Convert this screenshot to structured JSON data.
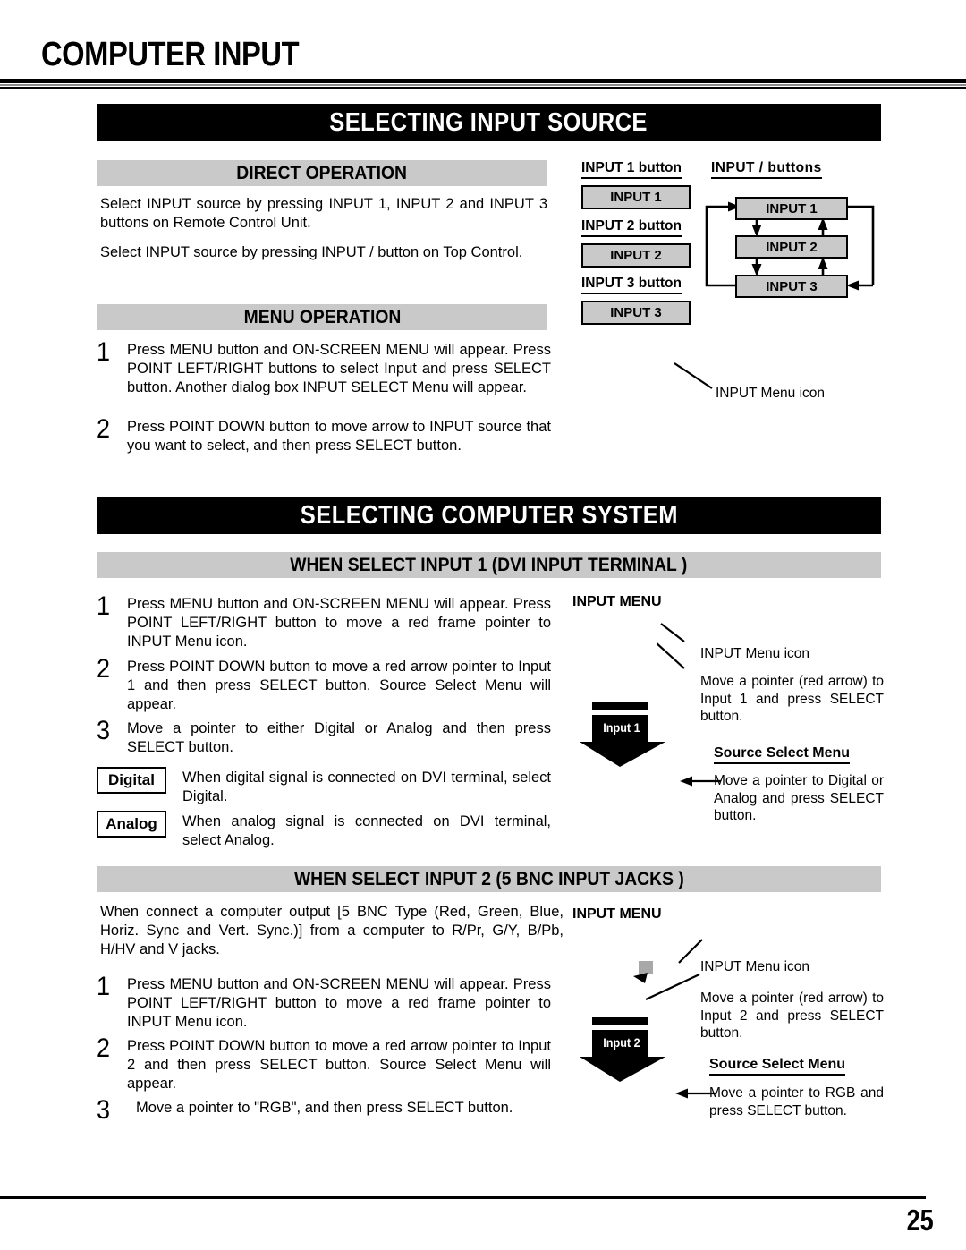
{
  "document": {
    "page_title": "COMPUTER INPUT",
    "page_number": "25"
  },
  "sections": {
    "input_source": {
      "banner": "SELECTING INPUT SOURCE",
      "direct_operation": {
        "bar": "DIRECT OPERATION",
        "paragraphs": [
          "Select INPUT source by pressing INPUT 1, INPUT 2 and INPUT 3 buttons on Remote Control Unit.",
          "Select INPUT source by pressing INPUT    /    button on Top Control."
        ]
      },
      "menu_operation": {
        "bar": "MENU OPERATION",
        "steps": [
          {
            "num": "1",
            "text": "Press MENU button and ON-SCREEN MENU will appear.  Press POINT LEFT/RIGHT buttons to select Input and press  SELECT button.  Another dialog box INPUT SELECT Menu will appear."
          },
          {
            "num": "2",
            "text": "Press POINT DOWN button to move arrow to INPUT source that you want to select, and then press SELECT button."
          }
        ]
      },
      "remote_buttons": {
        "labels": [
          "INPUT 1 button",
          "INPUT 2 button",
          "INPUT 3 button"
        ],
        "keys": [
          "INPUT 1",
          "INPUT 2",
          "INPUT 3"
        ],
        "cycle_label": "INPUT    /    buttons",
        "cycle_boxes": [
          "INPUT 1",
          "INPUT 2",
          "INPUT 3"
        ]
      },
      "menu_icon_callout": "INPUT Menu icon"
    },
    "computer_system": {
      "banner": "SELECTING COMPUTER SYSTEM",
      "input1": {
        "bar": "WHEN SELECT  INPUT 1 (DVI INPUT TERMINAL )",
        "steps": [
          {
            "num": "1",
            "text": "Press MENU button and ON-SCREEN MENU will appear.  Press POINT LEFT/RIGHT button to move a red frame pointer to INPUT Menu icon."
          },
          {
            "num": "2",
            "text": "Press POINT DOWN button to move a red arrow pointer to Input 1 and then press SELECT button.  Source Select Menu will appear."
          },
          {
            "num": "3",
            "text": "Move a pointer to either Digital or Analog and then press SELECT button."
          }
        ],
        "modes": [
          {
            "chip": "Digital",
            "text": "When digital signal is connected on DVI terminal, select Digital."
          },
          {
            "chip": "Analog",
            "text": "When analog signal is connected on DVI terminal, select Analog."
          }
        ],
        "menu_head": "INPUT MENU",
        "callout_icon": "INPUT Menu icon",
        "callout_move": "Move a pointer (red arrow) to Input 1 and press SELECT button.",
        "source_select_head": "Source Select Menu",
        "source_select_text": "Move a pointer to Digital or Analog and press SELECT button.",
        "arrow_label": "Input 1"
      },
      "input2": {
        "bar": "WHEN SELECT INPUT 2 (5 BNC INPUT JACKS )",
        "intro": "When connect a computer output [5 BNC Type (Red, Green, Blue, Horiz. Sync and Vert. Sync.)] from a computer to R/Pr, G/Y, B/Pb, H/HV and V jacks.",
        "steps": [
          {
            "num": "1",
            "text": "Press MENU button and ON-SCREEN MENU will appear.  Press POINT LEFT/RIGHT button to move a red frame pointer to INPUT Menu icon."
          },
          {
            "num": "2",
            "text": "Press POINT DOWN button to move a red arrow pointer to Input 2 and then press SELECT button.  Source Select Menu will appear."
          },
          {
            "num": "3",
            "text": "Move a pointer to  \"RGB\", and then press SELECT button."
          }
        ],
        "menu_head": "INPUT MENU",
        "callout_icon": "INPUT Menu icon",
        "callout_move": "Move a pointer (red arrow) to Input 2 and press SELECT button.",
        "source_select_head": "Source Select Menu",
        "source_select_text": "Move a pointer to RGB and press SELECT button.",
        "arrow_label": "Input 2"
      }
    }
  },
  "colors": {
    "banner_bg": "#000000",
    "banner_fg": "#ffffff",
    "graybar_bg": "#c9c9c9",
    "key_bg": "#c9c9c9",
    "icon_gray": "#a8a8a8"
  }
}
